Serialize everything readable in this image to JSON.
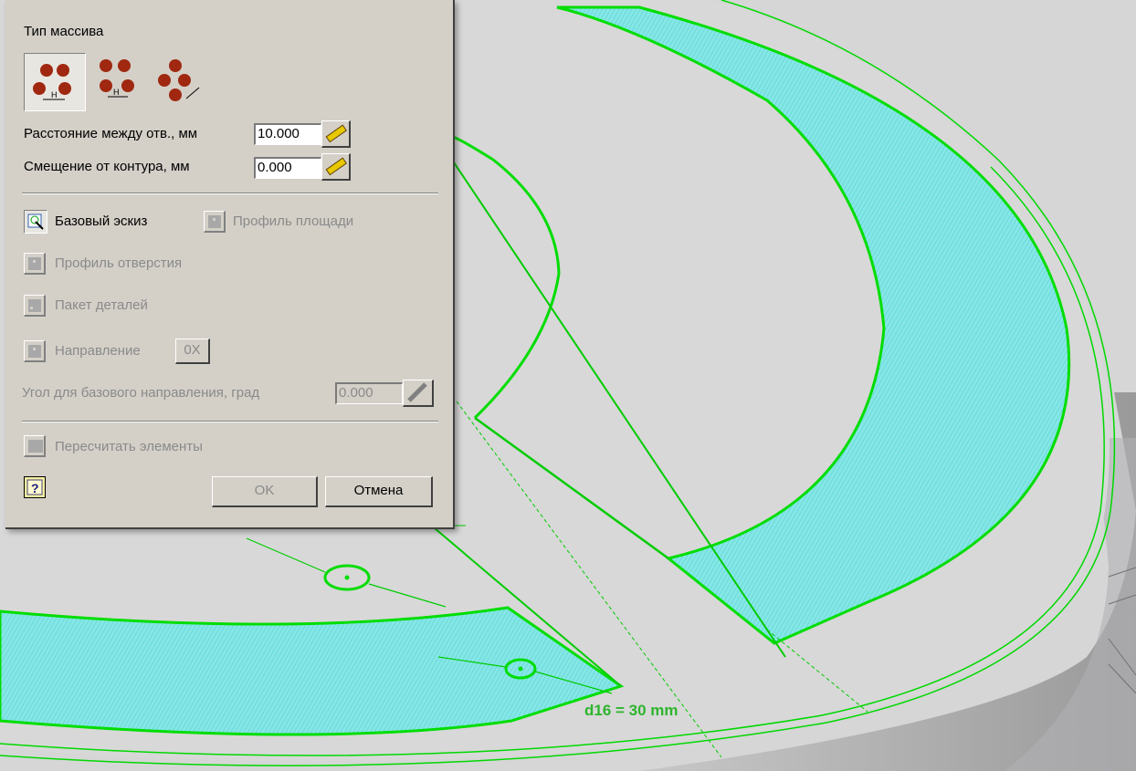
{
  "panel": {
    "array_type_label": "Тип массива",
    "distance_label": "Расстояние между отв., мм",
    "distance_value": "10.000",
    "offset_label": "Смещение от контура, мм",
    "offset_value": "0.000",
    "base_sketch_label": "Базовый эскиз",
    "area_profile_label": "Профиль площади",
    "hole_profile_label": "Профиль отверстия",
    "parts_package_label": "Пакет деталей",
    "direction_label": "Направление",
    "direction_axis": "0X",
    "angle_label": "Угол для базового направления, град",
    "angle_value": "0.000",
    "recalc_label": "Пересчитать элементы",
    "ok_label": "OK",
    "cancel_label": "Отмена"
  },
  "viewport": {
    "dimension_label": "d16 = 30 mm"
  },
  "colors": {
    "panel_bg": "#d4d0c8",
    "sketch_green": "#00e000",
    "hatch_cyan": "#7fe3e3",
    "model_gray": "#d4d4d4"
  }
}
